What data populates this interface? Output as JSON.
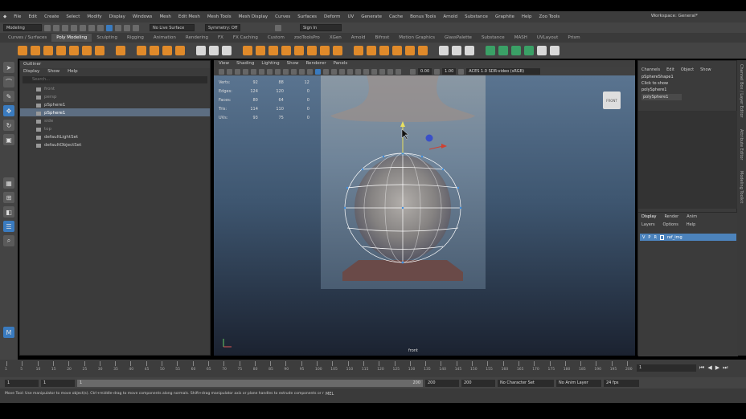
{
  "menubar": {
    "items": [
      "File",
      "Edit",
      "Create",
      "Select",
      "Modify",
      "Display",
      "Windows",
      "Mesh",
      "Edit Mesh",
      "Mesh Tools",
      "Mesh Display",
      "Curves",
      "Surfaces",
      "Deform",
      "UV",
      "Generate",
      "Cache",
      "Bonus Tools",
      "Arnold",
      "Substance",
      "Graphite",
      "Help",
      "Zoo Tools"
    ],
    "workspace": "Workspace: General*"
  },
  "statusline": {
    "mode": "Modeling",
    "live": "No Live Surface",
    "symmetry": "Symmetry: Off",
    "sign_in": "Sign In"
  },
  "shelf": {
    "tabs": [
      "Curves / Surfaces",
      "Poly Modeling",
      "Sculpting",
      "Rigging",
      "Animation",
      "Rendering",
      "FX",
      "FX Caching",
      "Custom",
      "zooToolsPro",
      "XGen",
      "Arnold",
      "Bifrost",
      "Motion Graphics",
      "GlassPalette",
      "Substance",
      "MASH",
      "UVLayout",
      "Prism"
    ],
    "active_index": 1
  },
  "outliner": {
    "title": "Outliner",
    "menu": [
      "Display",
      "Show",
      "Help"
    ],
    "search_placeholder": "Search...",
    "items": [
      {
        "label": "front",
        "dim": true
      },
      {
        "label": "persp",
        "dim": true
      },
      {
        "label": "pSphere1",
        "dim": false
      },
      {
        "label": "pSphere1",
        "dim": false,
        "selected": true
      },
      {
        "label": "side",
        "dim": true
      },
      {
        "label": "top",
        "dim": true
      },
      {
        "label": "defaultLightSet",
        "dim": false
      },
      {
        "label": "defaultObjectSet",
        "dim": false
      }
    ]
  },
  "viewport": {
    "menu": [
      "View",
      "Shading",
      "Lighting",
      "Show",
      "Renderer",
      "Panels"
    ],
    "field1": "0.00",
    "field2": "1.00",
    "colorspace": "ACES 1.0 SDR-video (sRGB)",
    "camera": "front",
    "view_cube": "FRONT",
    "hud": [
      {
        "label": "Verts:",
        "a": "92",
        "b": "88",
        "c": "12"
      },
      {
        "label": "Edges:",
        "a": "124",
        "b": "120",
        "c": "0"
      },
      {
        "label": "Faces:",
        "a": "80",
        "b": "64",
        "c": "0"
      },
      {
        "label": "Tris:",
        "a": "114",
        "b": "110",
        "c": "0"
      },
      {
        "label": "UVs:",
        "a": "93",
        "b": "75",
        "c": "0"
      }
    ]
  },
  "channelbox": {
    "menu": [
      "Channels",
      "Edit",
      "Object",
      "Show"
    ],
    "object": "pSphereShape1",
    "hint": "Click to show",
    "node1": "polySphere1",
    "node2": "polySphere1"
  },
  "layers": {
    "tabs": [
      "Display",
      "Render",
      "Anim"
    ],
    "menu": [
      "Layers",
      "Options",
      "Help"
    ],
    "layer_name": "ref_img"
  },
  "sidetabs": [
    "Channel Box / Layer Editor",
    "Attribute Editor",
    "Modeling Toolkit"
  ],
  "timeline": {
    "ticks": [
      "1",
      "5",
      "10",
      "15",
      "20",
      "25",
      "30",
      "35",
      "40",
      "45",
      "50",
      "55",
      "60",
      "65",
      "70",
      "75",
      "80",
      "85",
      "90",
      "95",
      "100",
      "105",
      "110",
      "115",
      "120",
      "125",
      "130",
      "135",
      "140",
      "145",
      "150",
      "155",
      "160",
      "165",
      "170",
      "175",
      "180",
      "185",
      "190",
      "195",
      "200"
    ],
    "current": "1"
  },
  "range": {
    "start": "1",
    "start2": "1",
    "inner_start": "1",
    "inner_end": "200",
    "end": "200",
    "end2": "200",
    "char_set": "No Character Set",
    "anim_layer": "No Anim Layer",
    "fps": "24 fps"
  },
  "cmdline": {
    "help": "Move Tool: Use manipulator to move object(s). Ctrl+middle-drag to move components along normals. Shift+drag manipulator axis or plane handles to extrude components or r",
    "mel": "MEL"
  },
  "colors": {
    "accent": "#e08a2a",
    "select": "#5d6e82",
    "layer": "#4c83bc"
  }
}
